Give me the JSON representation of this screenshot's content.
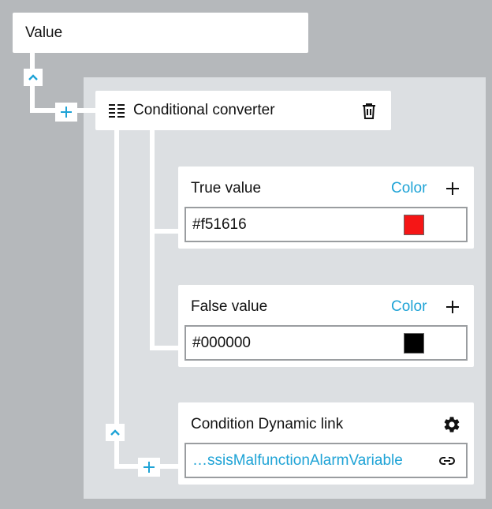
{
  "value_node": {
    "label": "Value"
  },
  "converter": {
    "label": "Conditional converter"
  },
  "true_value": {
    "label": "True value",
    "type_link": "Color",
    "value": "#f51616",
    "swatch_color": "#f51616"
  },
  "false_value": {
    "label": "False value",
    "type_link": "Color",
    "value": "#000000",
    "swatch_color": "#000000"
  },
  "condition": {
    "label": "Condition Dynamic link",
    "link_value": "…ssisMalfunctionAlarmVariable"
  },
  "colors": {
    "accent": "#1ea3d6",
    "background": "#b5b8bb",
    "area": "#dcdfe2"
  },
  "icons": [
    "chevron-up-icon",
    "plus-icon",
    "list-icon",
    "trash-icon",
    "gear-icon",
    "link-icon"
  ]
}
